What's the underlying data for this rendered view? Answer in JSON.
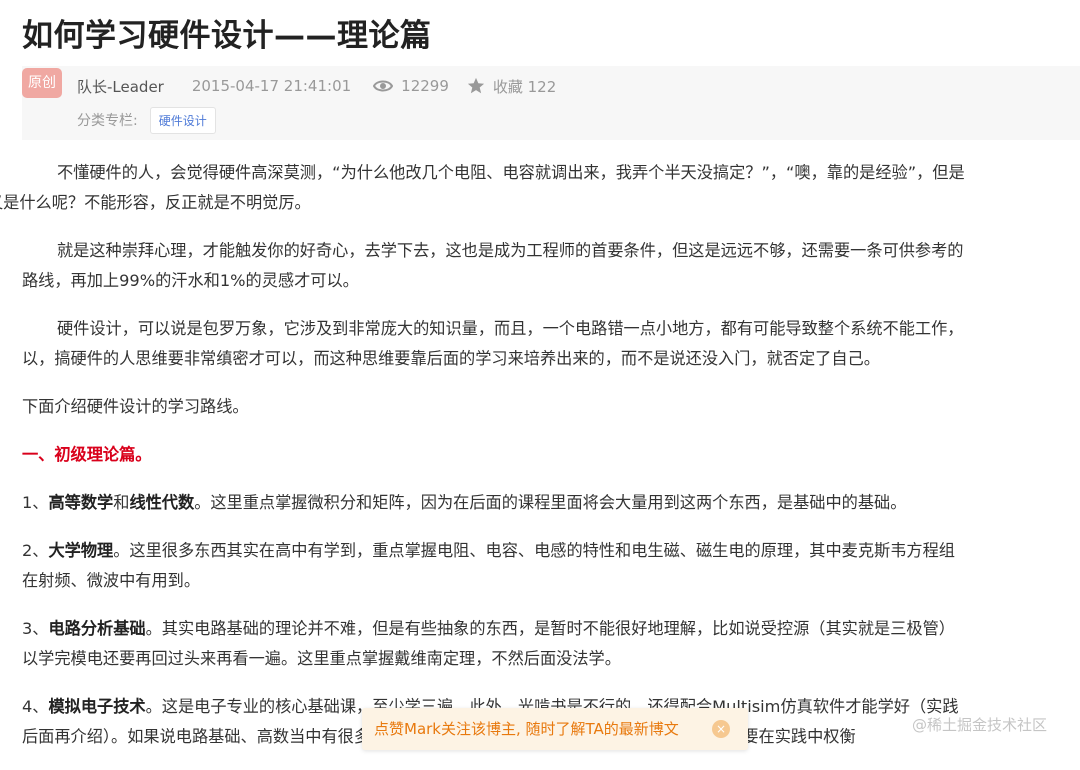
{
  "article": {
    "title": "如何学习硬件设计——理论篇",
    "badge": "原创",
    "author": "队长-Leader",
    "date": "2015-04-17 21:41:01",
    "views": "12299",
    "favorites": "收藏 122",
    "category_label": "分类专栏:",
    "category_tag": "硬件设计"
  },
  "content": {
    "p1_l1": "不懂硬件的人，会觉得硬件高深莫测，“为什么他改几个电阻、电容就调出来，我弄个半天没搞定？”，“噢，靠的是经验”，但是",
    "p1_l2": "又是什么呢？不能形容，反正就是不明觉厉。",
    "p2_l1": "就是这种崇拜心理，才能触发你的好奇心，去学下去，这也是成为工程师的首要条件，但这是远远不够，还需要一条可供参考的",
    "p2_l2": "路线，再加上99%的汗水和1%的灵感才可以。",
    "p3_l1": "硬件设计，可以说是包罗万象，它涉及到非常庞大的知识量，而且，一个电路错一点小地方，都有可能导致整个系统不能工作，",
    "p3_l2": "以，搞硬件的人思维要非常缜密才可以，而这种思维要靠后面的学习来培养出来的，而不是说还没入门，就否定了自己。",
    "p4": "下面介绍硬件设计的学习路线。",
    "section_head": "一、初级理论篇。",
    "i1_num": "1、",
    "i1_b1": "高等数学",
    "i1_and": "和",
    "i1_b2": "线性代数",
    "i1_rest": "。这里重点掌握微积分和矩阵，因为在后面的课程里面将会大量用到这两个东西，是基础中的基础。",
    "i2_num": "2、",
    "i2_b": "大学物理",
    "i2_rest": "。这里很多东西其实在高中有学到，重点掌握电阻、电容、电感的特性和电生磁、磁生电的原理，其中麦克斯韦方程组",
    "i2_l2": "在射频、微波中有用到。",
    "i3_num": "3、",
    "i3_b": "电路分析基础",
    "i3_rest": "。其实电路基础的理论并不难，但是有些抽象的东西，是暂时不能很好地理解，比如说受控源（其实就是三极管）",
    "i3_l2": "以学完模电还要再回过头来再看一遍。这里重点掌握戴维南定理，不然后面没法学。",
    "i4_num": "4、",
    "i4_b": "模拟电子技术",
    "i4_rest": "。这是电子专业的核心基础课，至少学三遍，此外，光啃书是不行的，还得配合Multisim仿真软件才能学好（实践",
    "i4_l2": "后面再介绍）。如果说电路基础、高数当中有很多抽象的东西，那么模电中则是不明确、多样化的，需要在实践中权衡"
  },
  "toast": {
    "text": "点赞Mark关注该博主, 随时了解TA的最新博文",
    "close": "×"
  },
  "watermark": "@稀土掘金技术社区",
  "colors": {
    "accent_red": "#d9001b",
    "badge_bg": "#f0a8a2",
    "tag_blue": "#4e7ad7",
    "toast_text": "#e8790e"
  }
}
